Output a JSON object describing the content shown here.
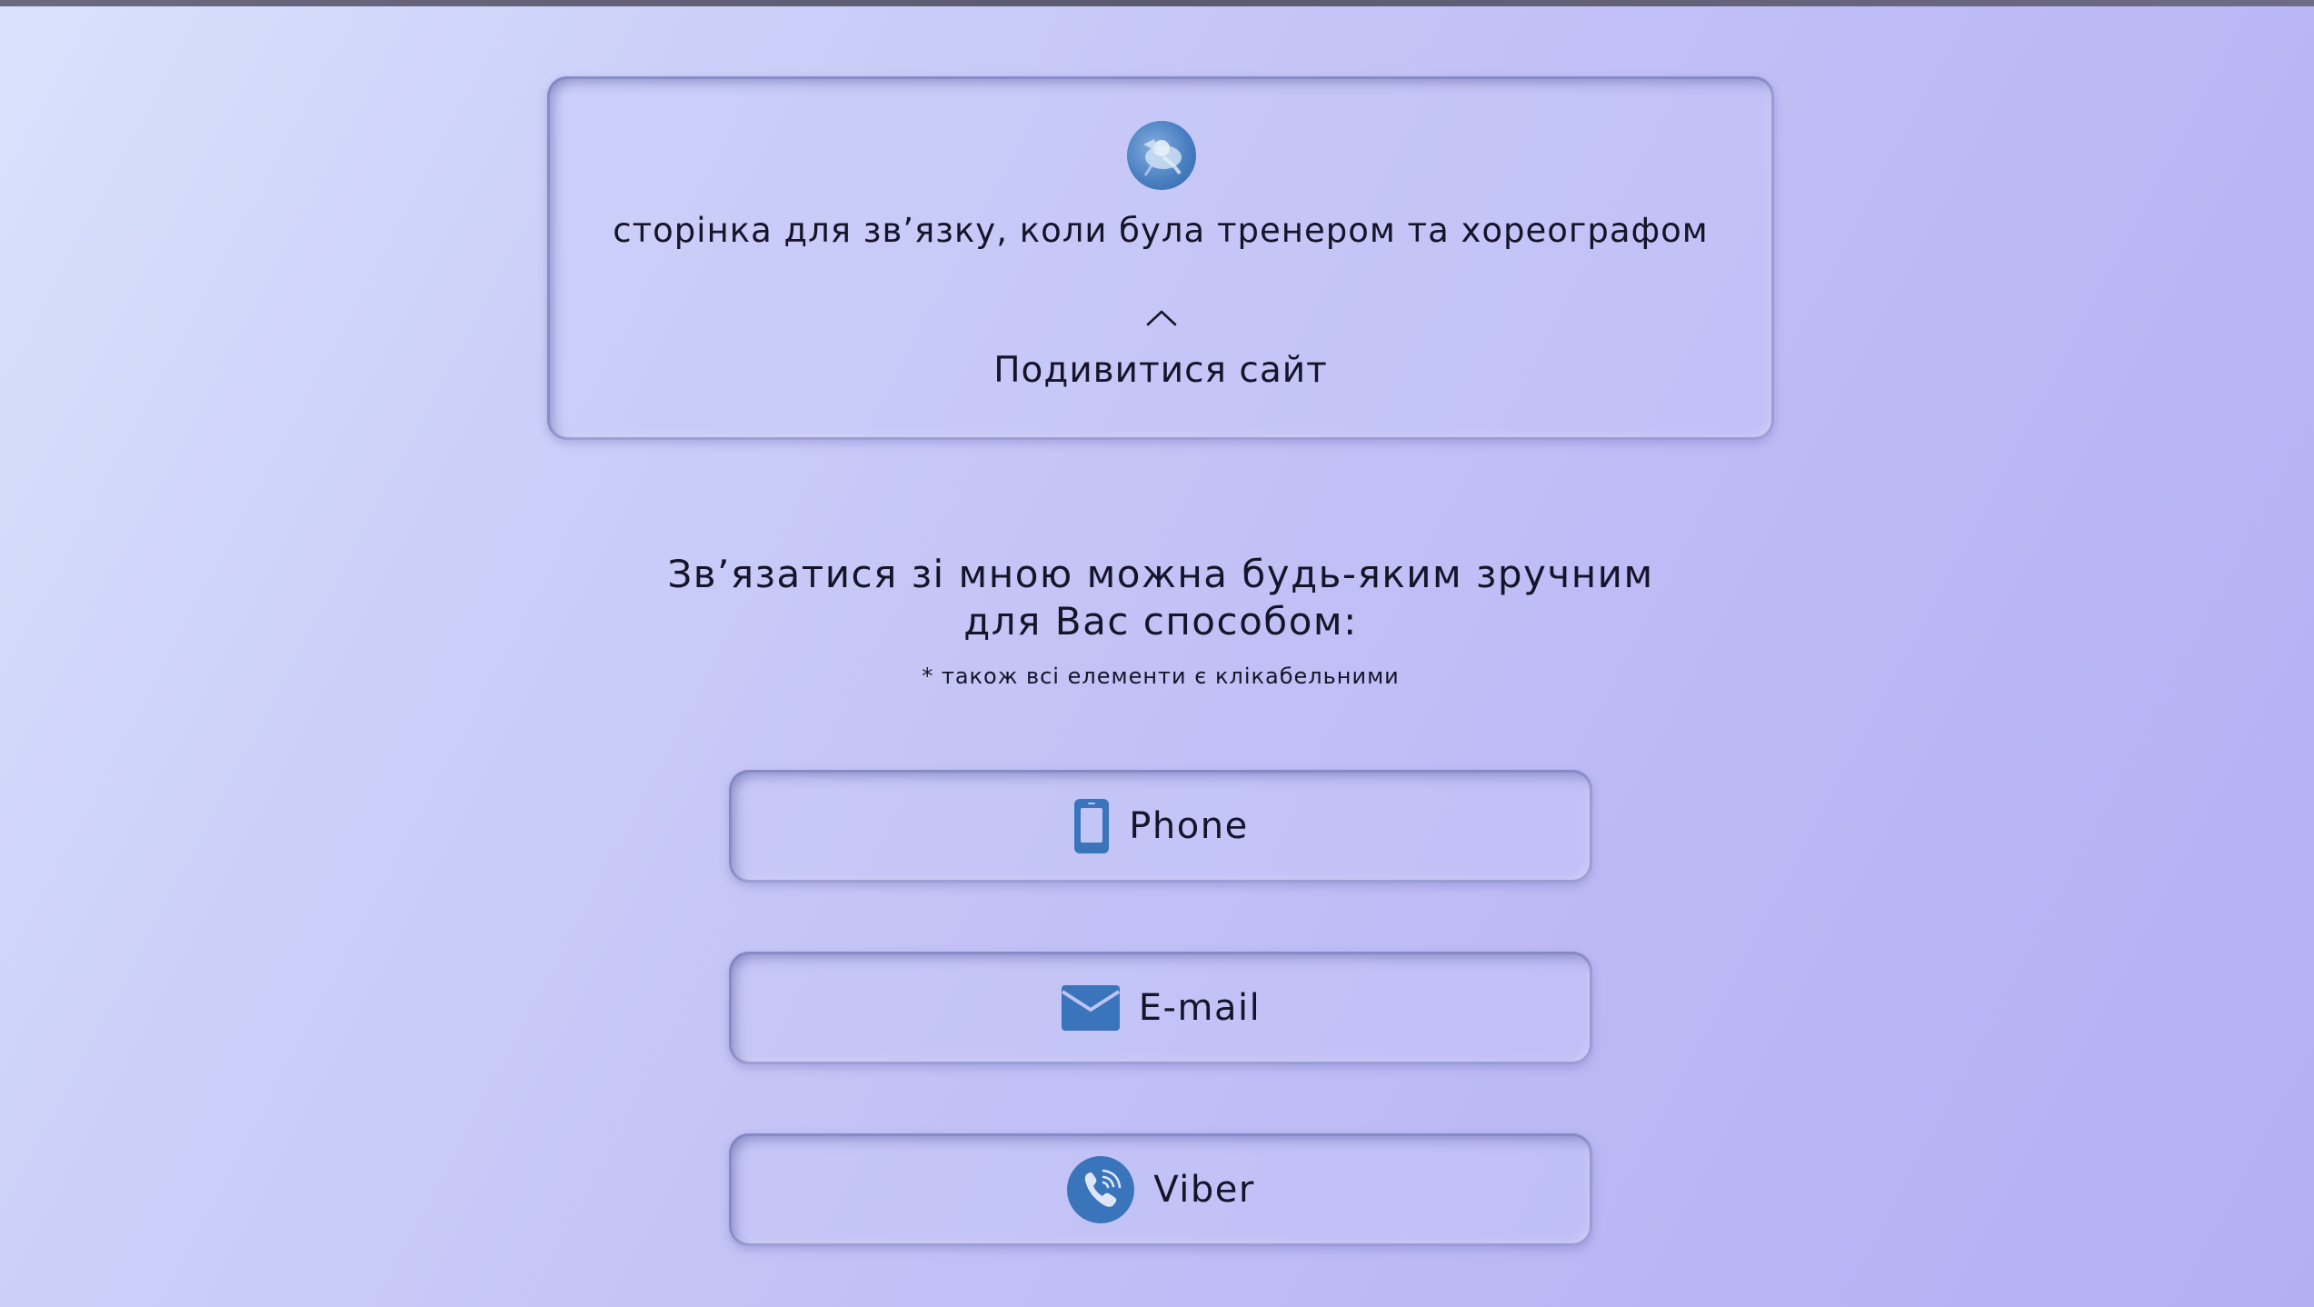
{
  "site_card": {
    "caption": "сторінка для зв’язку, коли була тренером та хореографом",
    "link_label": "Подивитися сайт",
    "avatar_icon": "dancer-avatar-icon",
    "toggle_icon": "chevron-up-icon"
  },
  "contact_section": {
    "heading": "Зв’язатися зі мною можна будь-яким зручним для Вас способом:",
    "note": "* також всі елементи є клікабельними"
  },
  "contacts": [
    {
      "label": "Phone",
      "icon": "phone-icon"
    },
    {
      "label": "E-mail",
      "icon": "envelope-icon"
    },
    {
      "label": "Viber",
      "icon": "viber-icon"
    }
  ],
  "colors": {
    "icon_blue": "#3a74bb",
    "text": "#15142a",
    "background_start": "#d9e2fc",
    "background_end": "#b3aff3"
  }
}
